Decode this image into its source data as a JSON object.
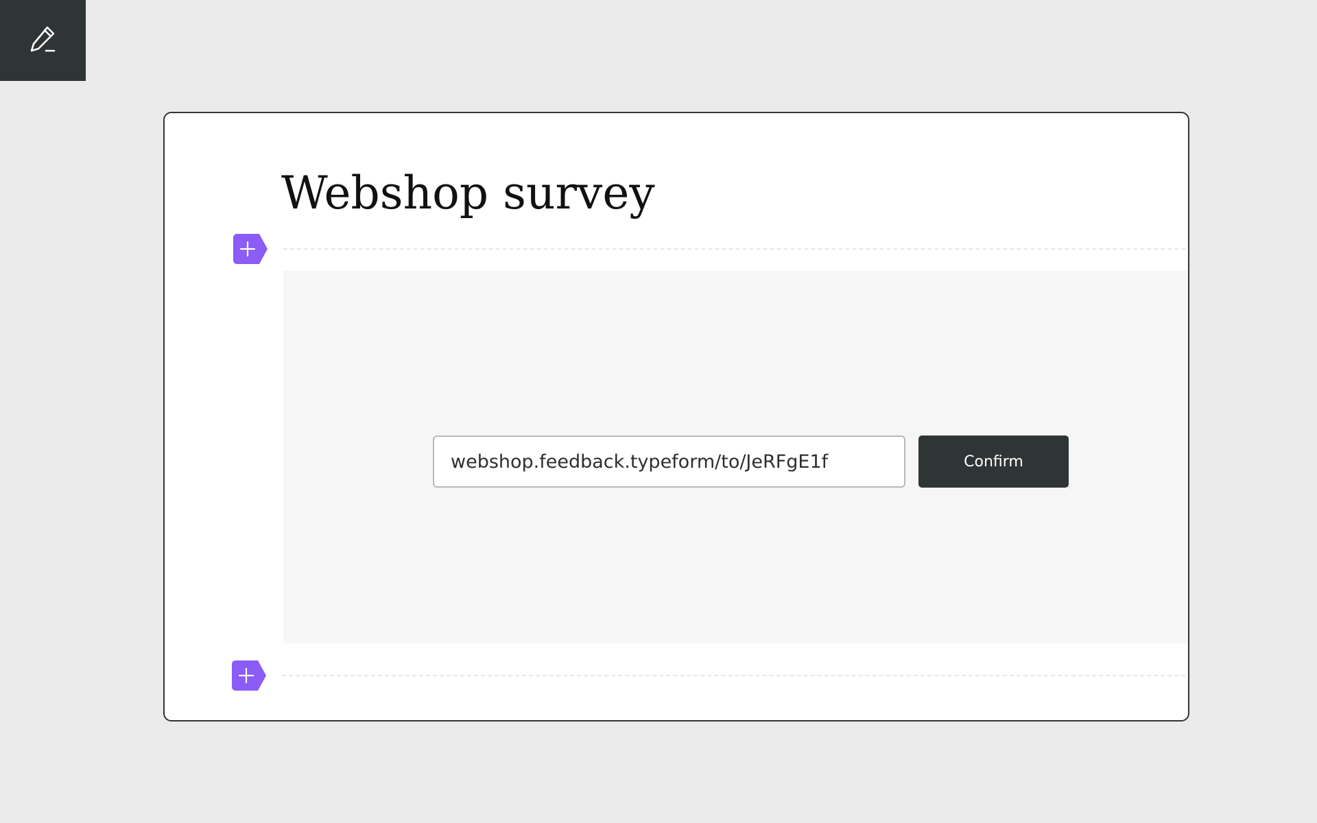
{
  "sidebar": {
    "edit_icon": "pencil-icon"
  },
  "form": {
    "title": "Webshop survey",
    "add_block_icon": "plus-icon",
    "accent_color": "#8B5CF6"
  },
  "embed": {
    "url_value": "webshop.feedback.typeform/to/JeRFgE1f",
    "confirm_label": "Confirm"
  },
  "colors": {
    "dark": "#2F3434",
    "page_background": "#EAEBEA",
    "embed_background": "#F6F6F6"
  }
}
